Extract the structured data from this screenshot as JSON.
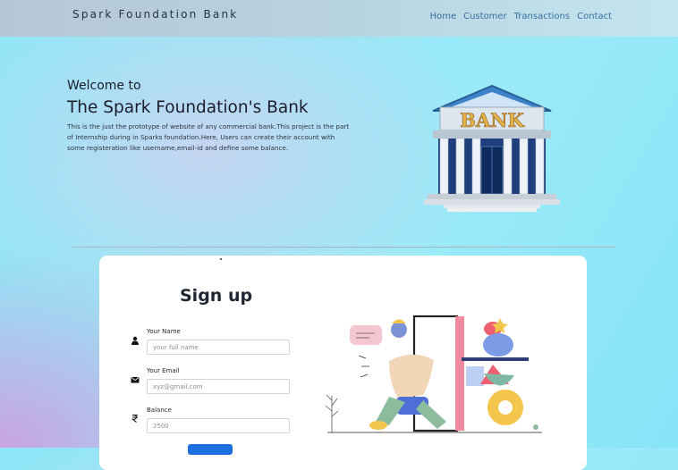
{
  "navbar": {
    "brand": "Spark Foundation Bank",
    "links": [
      {
        "label": "Home"
      },
      {
        "label": "Customer"
      },
      {
        "label": "Transactions"
      },
      {
        "label": "Contact"
      }
    ]
  },
  "hero": {
    "welcome": "Welcome to",
    "title": "The Spark Foundation's Bank",
    "description": "This is the just the prototype of website of any commercial bank.This project is the part of Internship during in Sparks foundation.Here, Users can create their account with some registeration like username,email-id and define some balance.",
    "bank_sign": "BANK"
  },
  "signup": {
    "title": "Sign up",
    "fields": [
      {
        "label": "Your Name",
        "placeholder": "your full name",
        "icon": "user-icon"
      },
      {
        "label": "Your Email",
        "placeholder": "xyz@gmail.com",
        "icon": "envelope-icon"
      },
      {
        "label": "Balance",
        "placeholder": "2500",
        "icon": "rupee-icon"
      }
    ]
  },
  "colors": {
    "nav_link": "#3a6ea3",
    "accent_button": "#1d6fe0",
    "bank_gold": "#e4b34a"
  }
}
